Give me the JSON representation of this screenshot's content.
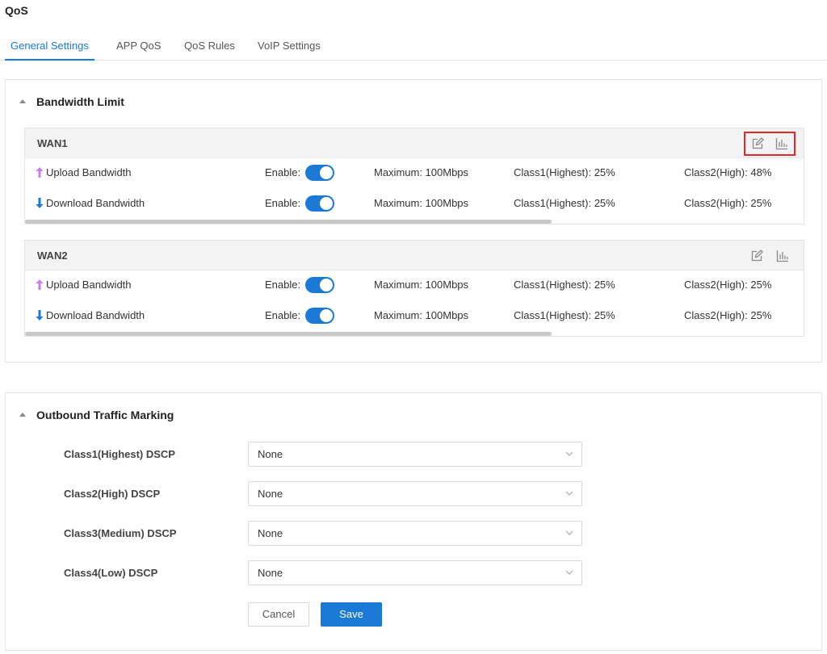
{
  "page": {
    "title": "QoS"
  },
  "tabs": [
    {
      "label": "General Settings",
      "active": true
    },
    {
      "label": "APP QoS",
      "active": false
    },
    {
      "label": "QoS Rules",
      "active": false
    },
    {
      "label": "VoIP Settings",
      "active": false
    }
  ],
  "colors": {
    "accent": "#1a7ad6",
    "upload_arrow": "#c77ee8",
    "download_arrow": "#1a7ad6",
    "highlight_box": "#e02828"
  },
  "bandwidth": {
    "title": "Bandwidth Limit",
    "wans": [
      {
        "name": "WAN1",
        "actions": {
          "edit_icon": "edit-icon",
          "stats_icon": "bar-chart-icon",
          "highlighted": true
        },
        "rows": [
          {
            "direction_icon": "arrow-up-icon",
            "label": "Upload Bandwidth",
            "enable_label": "Enable:",
            "enabled": true,
            "maximum": "Maximum: 100Mbps",
            "class1": "Class1(Highest): 25%",
            "class2": "Class2(High): 48%"
          },
          {
            "direction_icon": "arrow-down-icon",
            "label": "Download Bandwidth",
            "enable_label": "Enable:",
            "enabled": true,
            "maximum": "Maximum: 100Mbps",
            "class1": "Class1(Highest): 25%",
            "class2": "Class2(High): 25%"
          }
        ]
      },
      {
        "name": "WAN2",
        "actions": {
          "edit_icon": "edit-icon",
          "stats_icon": "bar-chart-icon",
          "highlighted": false
        },
        "rows": [
          {
            "direction_icon": "arrow-up-icon",
            "label": "Upload Bandwidth",
            "enable_label": "Enable:",
            "enabled": true,
            "maximum": "Maximum: 100Mbps",
            "class1": "Class1(Highest): 25%",
            "class2": "Class2(High): 25%"
          },
          {
            "direction_icon": "arrow-down-icon",
            "label": "Download Bandwidth",
            "enable_label": "Enable:",
            "enabled": true,
            "maximum": "Maximum: 100Mbps",
            "class1": "Class1(Highest): 25%",
            "class2": "Class2(High): 25%"
          }
        ]
      }
    ]
  },
  "outbound": {
    "title": "Outbound Traffic Marking",
    "fields": [
      {
        "label": "Class1(Highest) DSCP",
        "value": "None"
      },
      {
        "label": "Class2(High) DSCP",
        "value": "None"
      },
      {
        "label": "Class3(Medium) DSCP",
        "value": "None"
      },
      {
        "label": "Class4(Low) DSCP",
        "value": "None"
      }
    ],
    "cancel_label": "Cancel",
    "save_label": "Save"
  }
}
